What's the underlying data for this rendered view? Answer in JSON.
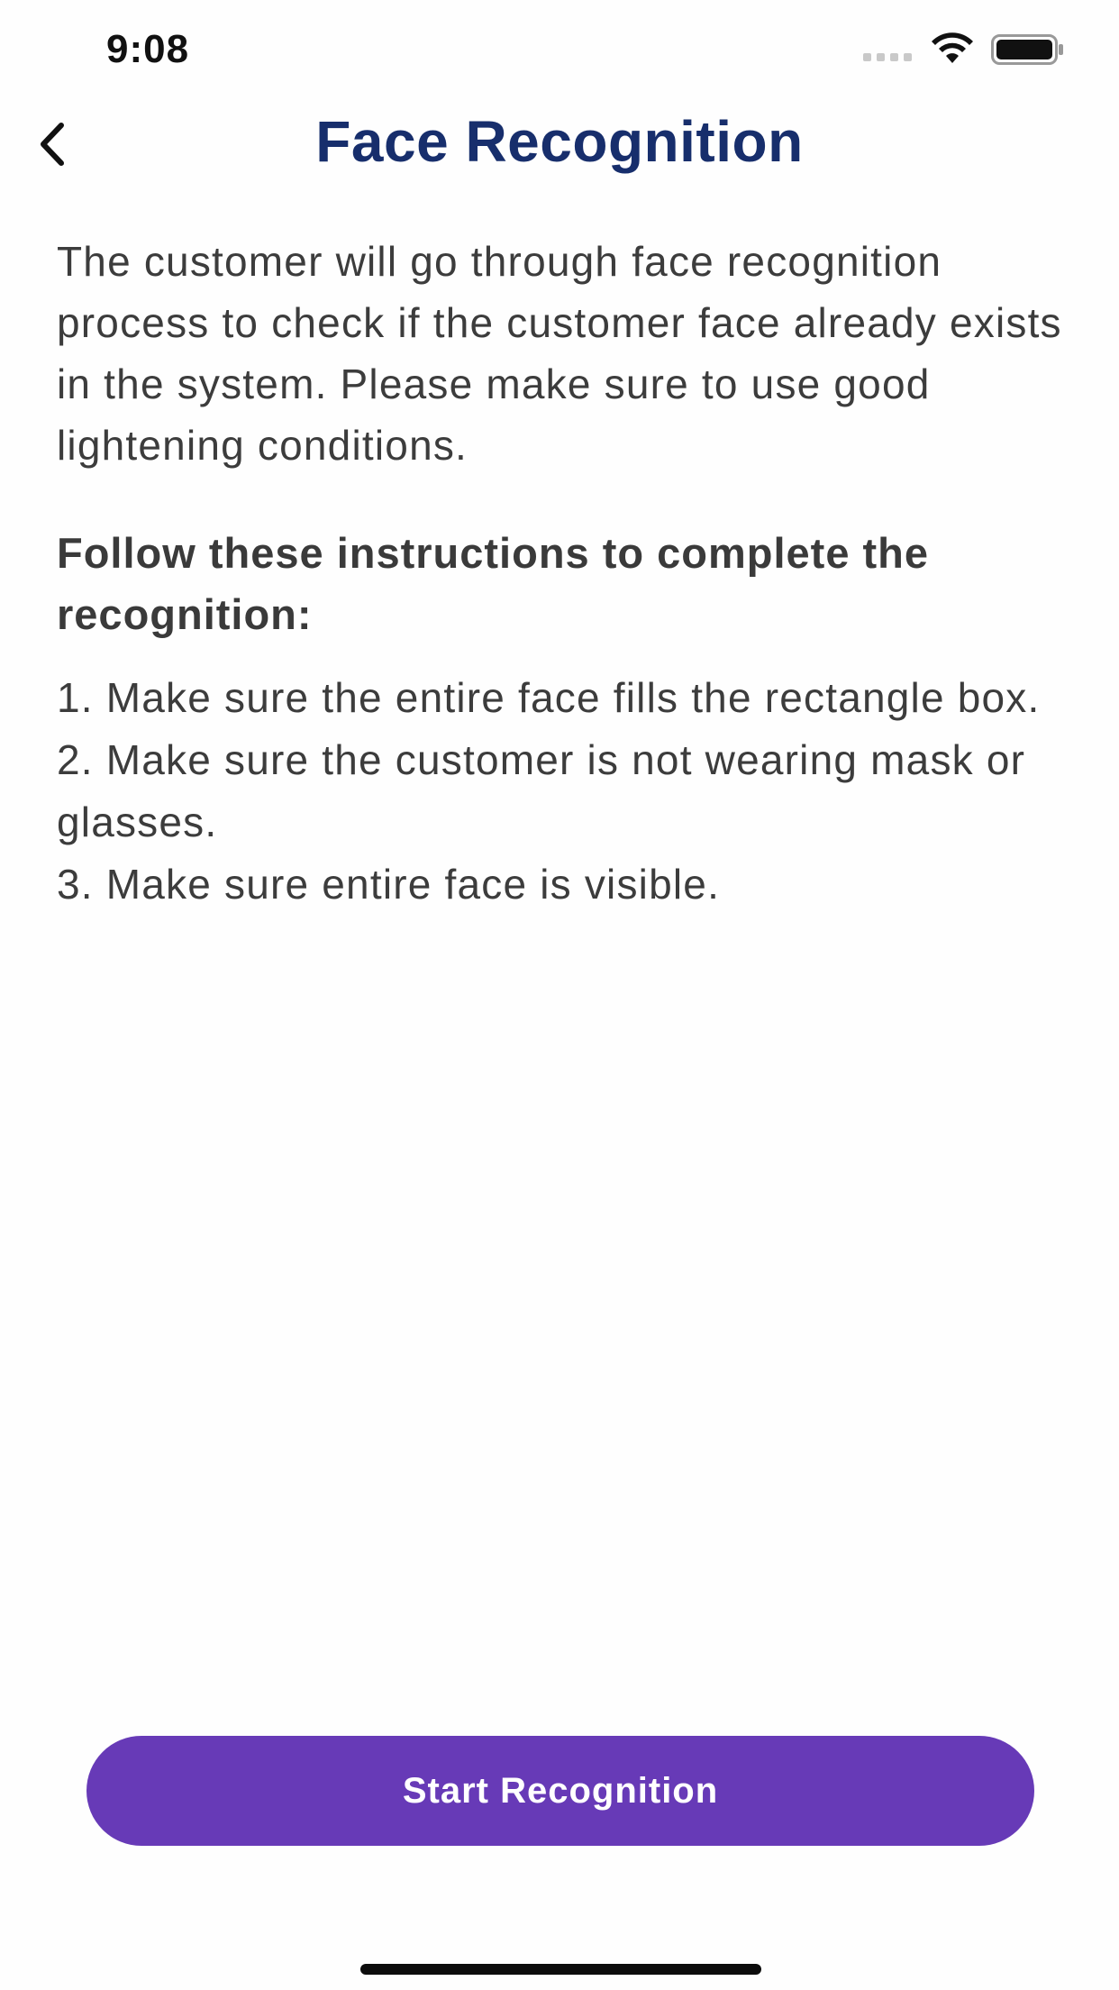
{
  "status_bar": {
    "time": "9:08"
  },
  "nav": {
    "title": "Face Recognition",
    "back_icon": "chevron-left-icon"
  },
  "content": {
    "intro": "The customer will go through face recognition process to check if the customer face already exists in the system. Please make sure to use good lightening conditions.",
    "instructions_heading": "Follow these instructions to complete the recognition:",
    "steps": [
      "1. Make sure the entire face fills the rectangle box.",
      "2. Make sure the customer is not wearing mask or glasses.",
      "3. Make sure entire face is visible."
    ]
  },
  "actions": {
    "start_label": "Start Recognition"
  },
  "colors": {
    "title": "#172e6c",
    "body_text": "#3c3c3c",
    "button_bg": "#673ab7",
    "button_text": "#ffffff",
    "background": "#fefefe"
  }
}
